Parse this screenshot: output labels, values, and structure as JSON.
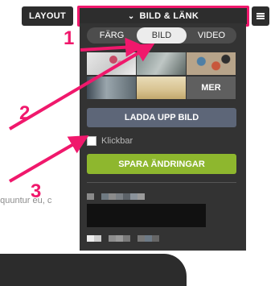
{
  "toolbar": {
    "layout_label": "LAYOUT",
    "bild_lank_label": "BILD & LÄNK"
  },
  "panel": {
    "tabs": [
      {
        "label": "FÄRG",
        "active": false
      },
      {
        "label": "BILD",
        "active": true
      },
      {
        "label": "VIDEO",
        "active": false
      }
    ],
    "more_label": "MER",
    "upload_label": "LADDA UPP BILD",
    "checkbox_label": "Klickbar",
    "checkbox_checked": false,
    "save_label": "SPARA ÄNDRINGAR"
  },
  "background": {
    "text_left": "equuntur eu, c",
    "text_right": "c"
  },
  "annotations": [
    "1",
    "2",
    "3"
  ],
  "colors": {
    "accent": "#f0186c",
    "save": "#8eb72e",
    "upload": "#5d6678",
    "panel": "#333333"
  }
}
